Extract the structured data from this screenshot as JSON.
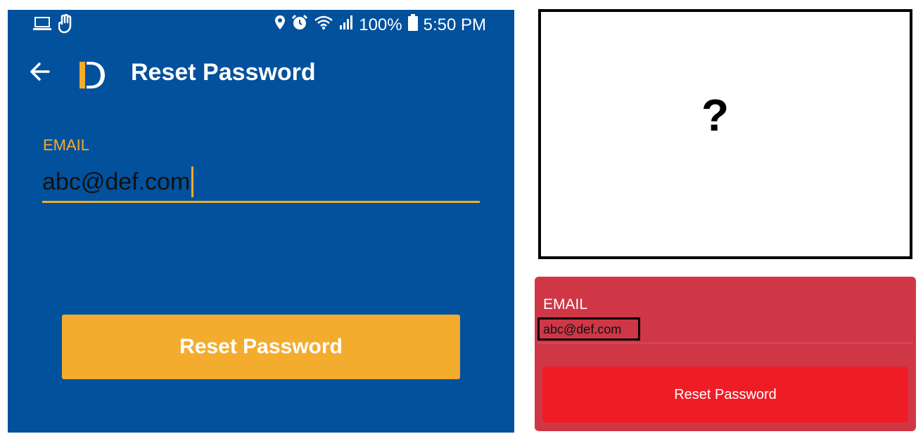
{
  "status_bar": {
    "battery_percent": "100%",
    "time": "5:50 PM",
    "icons_left": [
      "laptop-icon",
      "hand-icon"
    ],
    "icons_right": [
      "location-icon",
      "alarm-icon",
      "wifi-icon",
      "signal-icon",
      "battery-icon"
    ]
  },
  "app_bar": {
    "title": "Reset Password"
  },
  "form": {
    "email_label": "EMAIL",
    "email_value": "abc@def.com",
    "button_label": "Reset Password"
  },
  "question_box": {
    "symbol": "?"
  },
  "red_card": {
    "email_label": "EMAIL",
    "email_value": "abc@def.com",
    "button_label": "Reset Password"
  },
  "colors": {
    "phone_background": "#02519d",
    "accent": "#f2ad2b",
    "red_card": "#cf3747",
    "red_button": "#ee1c25"
  }
}
